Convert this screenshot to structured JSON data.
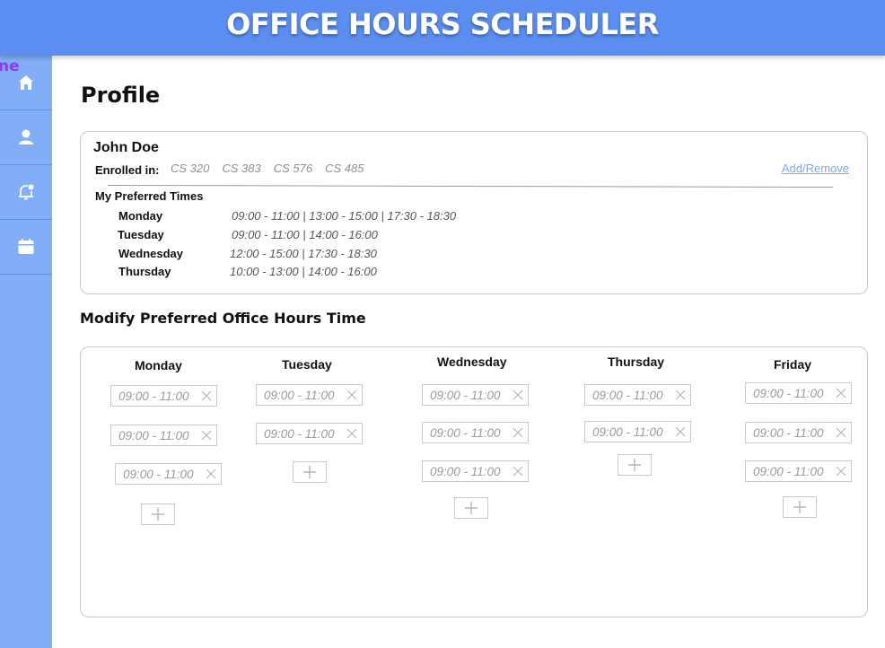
{
  "header": {
    "title": "OFFICE HOURS SCHEDULER"
  },
  "sidebar": {
    "cut_label": "ne",
    "items": [
      {
        "icon": "home-icon",
        "label": "Home"
      },
      {
        "icon": "user-icon",
        "label": "Profile"
      },
      {
        "icon": "bell-icon",
        "label": "Notifications"
      },
      {
        "icon": "calendar-icon",
        "label": "Calendar"
      }
    ],
    "bg_color": "#82aef7"
  },
  "profile": {
    "heading": "Profile",
    "name": "John Doe",
    "enrolled_label": "Enrolled in:",
    "courses": [
      "CS 320",
      "CS 383",
      "CS 576",
      "CS 485"
    ],
    "add_remove": "Add/Remove",
    "preferred_title": "My Preferred  Times",
    "preferred": [
      {
        "day": "Monday",
        "times": "09:00 - 11:00   |  13:00 - 15:00  |  17:30 - 18:30"
      },
      {
        "day": "Tuesday",
        "times": "09:00 - 11:00   |  14:00 - 16:00"
      },
      {
        "day": "Wednesday",
        "times": "12:00 - 15:00  |  17:30 - 18:30"
      },
      {
        "day": "Thursday",
        "times": "10:00 - 13:00   |  14:00 - 16:00"
      }
    ]
  },
  "modify": {
    "heading": "Modify Preferred Office Hours Time",
    "days": [
      {
        "name": "Monday",
        "slots": [
          "09:00 - 11:00",
          "09:00 - 11:00",
          "09:00 - 11:00"
        ]
      },
      {
        "name": "Tuesday",
        "slots": [
          "09:00 - 11:00",
          "09:00 - 11:00"
        ]
      },
      {
        "name": "Wednesday",
        "slots": [
          "09:00 - 11:00",
          "09:00 - 11:00",
          "09:00 - 11:00"
        ]
      },
      {
        "name": "Thursday",
        "slots": [
          "09:00 - 11:00",
          "09:00 - 11:00"
        ]
      },
      {
        "name": "Friday",
        "slots": [
          "09:00 - 11:00",
          "09:00 - 11:00",
          "09:00 - 11:00"
        ]
      }
    ]
  },
  "colors": {
    "header": "#5b8ef0",
    "sidebar": "#82aef7",
    "link": "#7ea6ec",
    "accent_text": "#8a3df0"
  }
}
